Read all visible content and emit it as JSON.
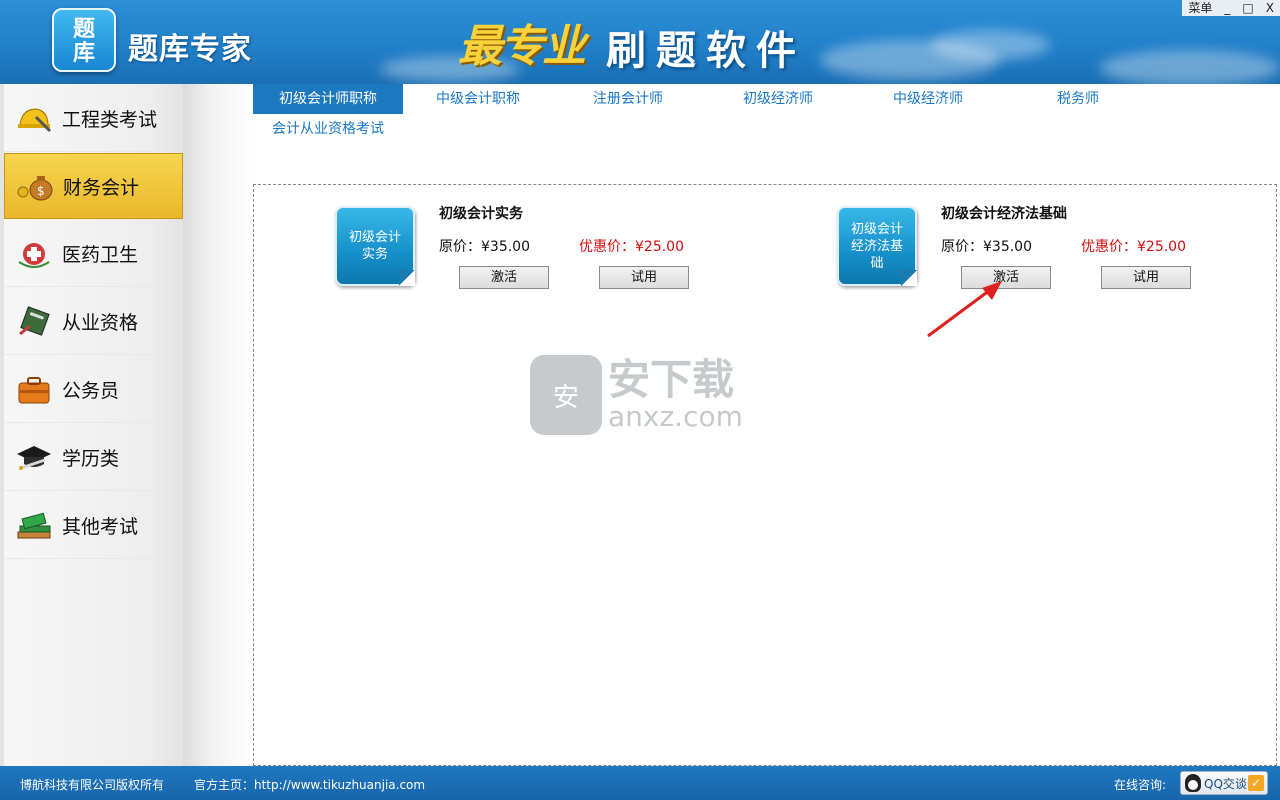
{
  "header": {
    "logo_text": [
      "题",
      "库"
    ],
    "app_title": "题库专家",
    "brand_art": "最专业",
    "slogan": "刷题软件",
    "window_controls": {
      "menu": "菜单",
      "minimize": "_",
      "maximize": "□",
      "close": "X"
    }
  },
  "sidebar": {
    "items": [
      {
        "label": "工程类考试",
        "icon": "hard-hat-icon",
        "active": false
      },
      {
        "label": "财务会计",
        "icon": "money-bag-icon",
        "active": true
      },
      {
        "label": "医药卫生",
        "icon": "medical-icon",
        "active": false
      },
      {
        "label": "从业资格",
        "icon": "certificate-icon",
        "active": false
      },
      {
        "label": "公务员",
        "icon": "briefcase-icon",
        "active": false
      },
      {
        "label": "学历类",
        "icon": "graduation-cap-icon",
        "active": false
      },
      {
        "label": "其他考试",
        "icon": "books-icon",
        "active": false
      }
    ]
  },
  "tabs": [
    {
      "label": "初级会计师职称",
      "active": true
    },
    {
      "label": "中级会计职称",
      "active": false
    },
    {
      "label": "注册会计师",
      "active": false
    },
    {
      "label": "初级经济师",
      "active": false
    },
    {
      "label": "中级经济师",
      "active": false
    },
    {
      "label": "税务师",
      "active": false
    },
    {
      "label": "会计从业资格考试",
      "active": false
    }
  ],
  "courses": [
    {
      "icon_text": "初级会计实务",
      "title": "初级会计实务",
      "price_label": "原价：",
      "price": "¥35.00",
      "sale_label": "优惠价：",
      "sale_price": "¥25.00",
      "activate_label": "激活",
      "trial_label": "试用"
    },
    {
      "icon_text": "初级会计经济法基础",
      "title": "初级会计经济法基础",
      "price_label": "原价：",
      "price": "¥35.00",
      "sale_label": "优惠价：",
      "sale_price": "¥25.00",
      "activate_label": "激活",
      "trial_label": "试用"
    }
  ],
  "watermark": {
    "glyph": "安",
    "cn": "安下载",
    "en": "anxz.com"
  },
  "footer": {
    "copyright": "博航科技有限公司版权所有",
    "homepage": "官方主页：http://www.tikuzhuanjia.com",
    "consult_label": "在线咨询:",
    "qq_label": "QQ交谈"
  },
  "colors": {
    "accent": "#1c79c0",
    "sale_red": "#d01010",
    "active_side": "#f0c63c"
  }
}
